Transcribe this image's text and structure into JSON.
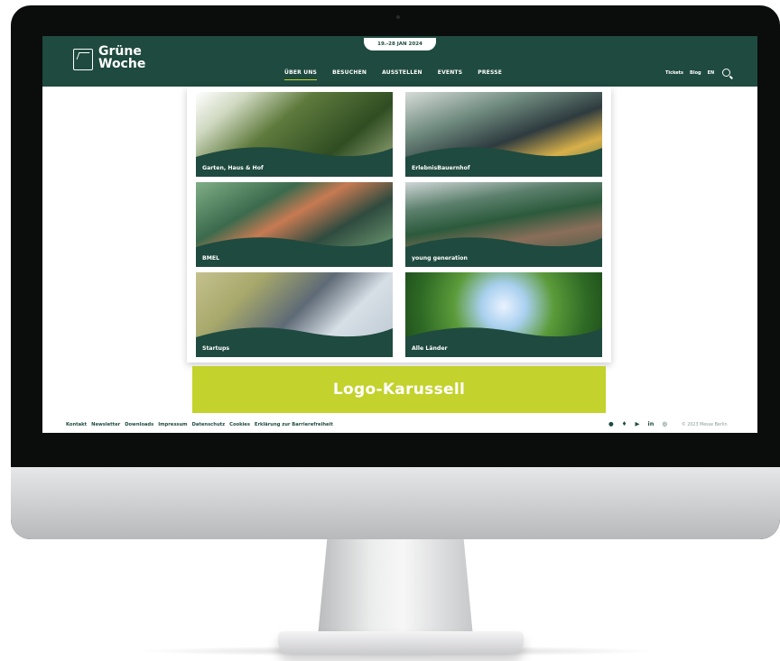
{
  "header": {
    "date_badge": "19.-28 JAN 2024",
    "logo_line1": "Grüne",
    "logo_line2": "Woche",
    "nav": [
      "ÜBER UNS",
      "BESUCHEN",
      "AUSSTELLEN",
      "EVENTS",
      "PRESSE"
    ],
    "utility": {
      "tickets": "Tickets",
      "blog": "Blog",
      "language": "EN"
    }
  },
  "dropdown": {
    "tiles": [
      {
        "label": "Garten, Haus & Hof"
      },
      {
        "label": "ErlebnisBauernhof"
      },
      {
        "label": "BMEL"
      },
      {
        "label": "young generation"
      },
      {
        "label": "Startups"
      },
      {
        "label": "Alle Länder"
      }
    ]
  },
  "carousel": {
    "label": "Logo-Karussell"
  },
  "footer": {
    "links": [
      "Kontakt",
      "Newsletter",
      "Downloads",
      "Impressum",
      "Datenschutz",
      "Cookies",
      "Erklärung zur Barrierefreiheit"
    ],
    "social": [
      "facebook-icon",
      "twitter-icon",
      "youtube-icon",
      "linkedin-icon",
      "instagram-icon"
    ],
    "copyright": "© 2023 Messe Berlin"
  },
  "colors": {
    "brand_green": "#1f4a3f",
    "accent_lime": "#c3d22c"
  }
}
